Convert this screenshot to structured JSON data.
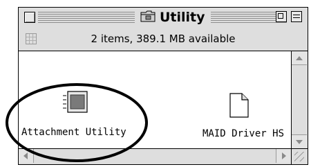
{
  "window": {
    "title": "Utility",
    "folder_icon": "folder-icon"
  },
  "infobar": {
    "text": "2 items, 389.1 MB available",
    "view_icon": "grid-view-icon"
  },
  "items": [
    {
      "label": "Attachment Utility",
      "icon": "application-icon"
    },
    {
      "label": "MAID Driver HS",
      "icon": "document-icon"
    }
  ],
  "annotation": {
    "shape": "ellipse",
    "color": "#000000",
    "target": "Attachment Utility"
  }
}
